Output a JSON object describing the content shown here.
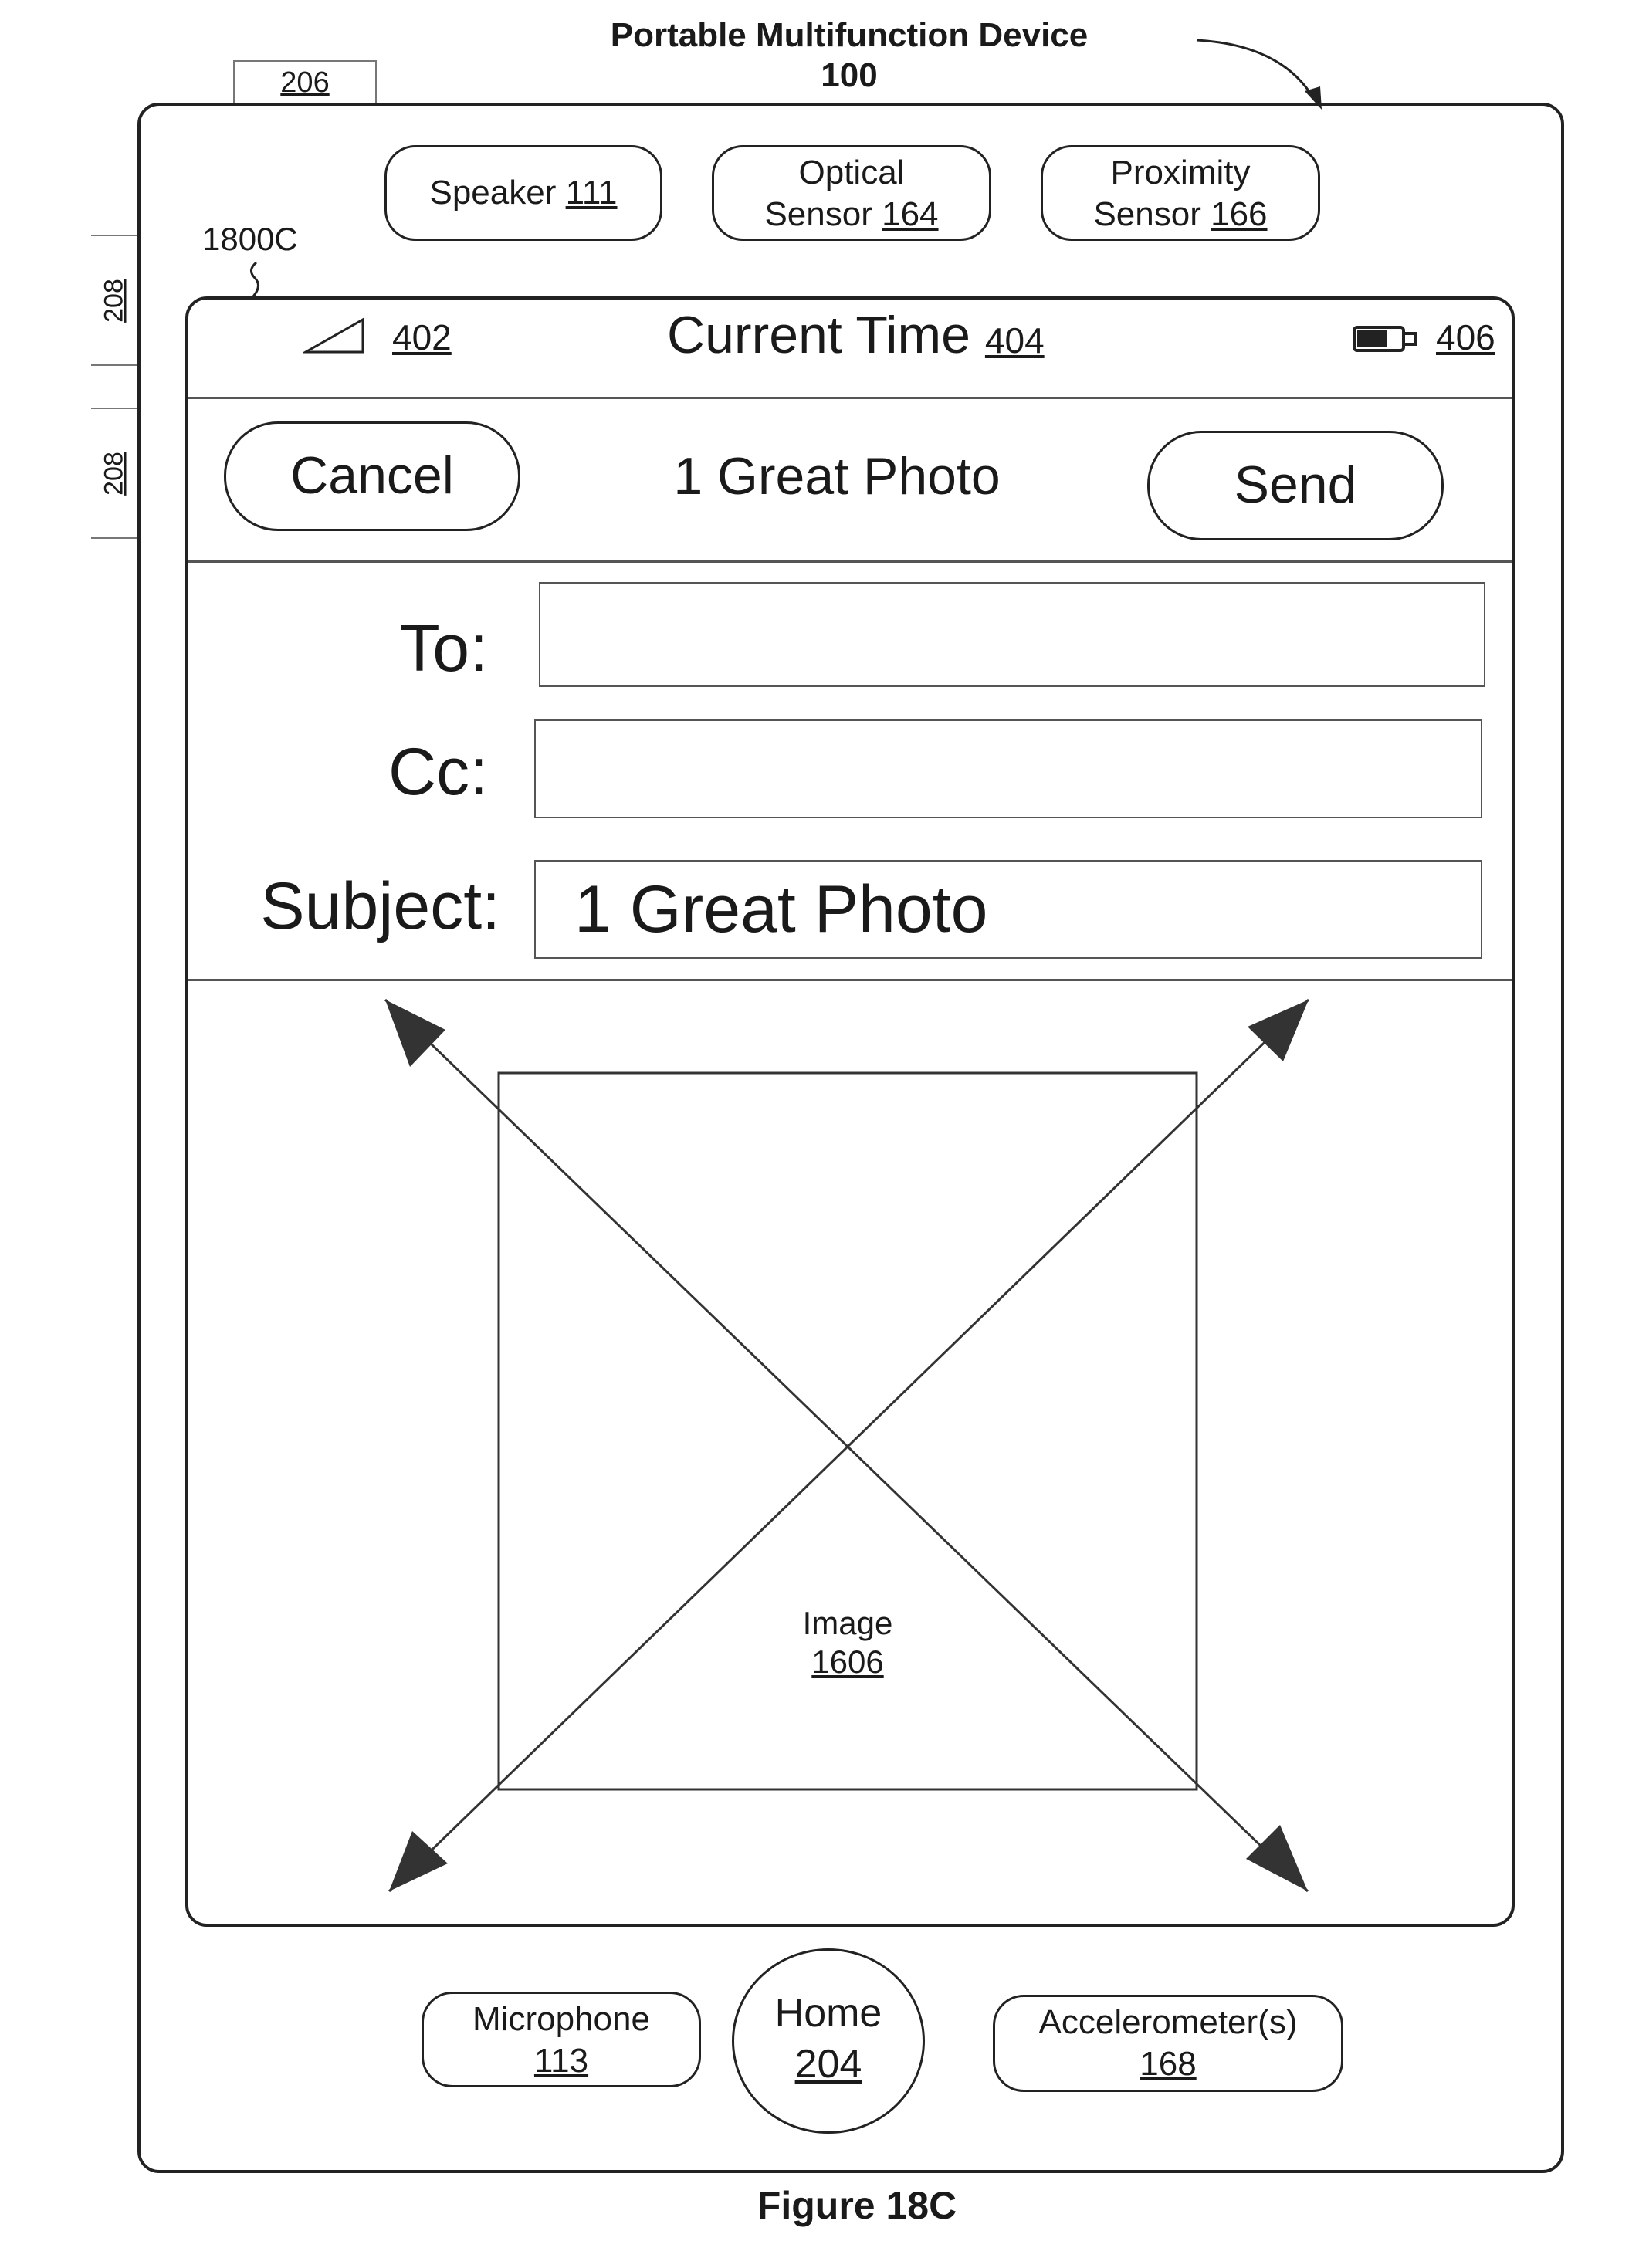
{
  "header": {
    "title": "Portable Multifunction Device",
    "ref": "100",
    "top_tab": "206",
    "side_tab_1": "208",
    "side_tab_2": "208",
    "screen_ref": "1800C"
  },
  "sensors": {
    "speaker_label": "Speaker",
    "speaker_ref": "111",
    "optical_line1": "Optical",
    "optical_line2": "Sensor",
    "optical_ref": "164",
    "proximity_line1": "Proximity",
    "proximity_line2": "Sensor",
    "proximity_ref": "166"
  },
  "status_bar": {
    "signal_ref": "402",
    "time_label": "Current Time",
    "time_ref": "404",
    "battery_ref": "406"
  },
  "nav": {
    "cancel_label": "Cancel",
    "title": "1 Great Photo",
    "send_label": "Send"
  },
  "form": {
    "to_label": "To:",
    "to_value": "",
    "cc_label": "Cc:",
    "cc_value": "",
    "subject_label": "Subject:",
    "subject_value": "1 Great Photo"
  },
  "image": {
    "label": "Image",
    "ref": "1606"
  },
  "bottom": {
    "microphone_label": "Microphone",
    "microphone_ref": "113",
    "home_label": "Home",
    "home_ref": "204",
    "accelerometer_label": "Accelerometer(s)",
    "accelerometer_ref": "168"
  },
  "caption": "Figure 18C"
}
